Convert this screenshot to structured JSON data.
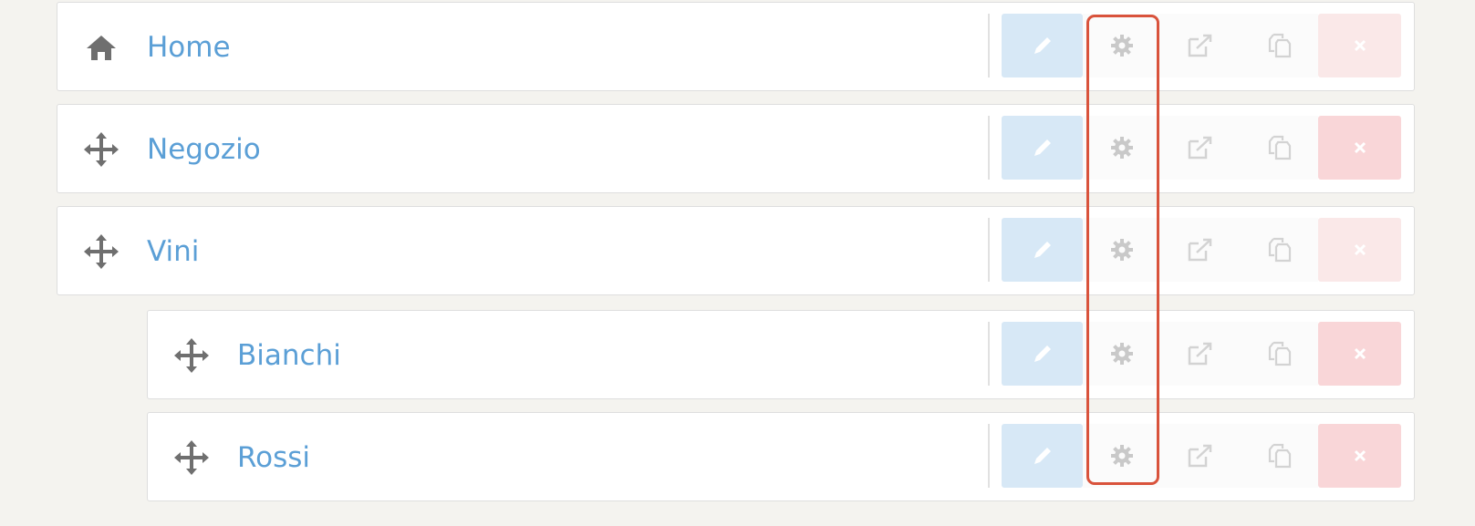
{
  "pages": [
    {
      "title": "Home",
      "lead_icon": "home-icon",
      "level": 0,
      "delete_faded": true
    },
    {
      "title": "Negozio",
      "lead_icon": "move-icon",
      "level": 0,
      "delete_faded": false
    },
    {
      "title": "Vini",
      "lead_icon": "move-icon",
      "level": 0,
      "delete_faded": true
    },
    {
      "title": "Bianchi",
      "lead_icon": "move-icon",
      "level": 1,
      "delete_faded": false
    },
    {
      "title": "Rossi",
      "lead_icon": "move-icon",
      "level": 1,
      "delete_faded": false
    }
  ],
  "actions": [
    "edit-icon",
    "gear-icon",
    "external-link-icon",
    "duplicate-icon",
    "close-icon"
  ],
  "colors": {
    "title_link": "#5b9fd6",
    "edit_bg": "#d7e8f6",
    "delete_bg": "#f9d6d8",
    "highlight": "#d9533c",
    "background": "#f4f3ef"
  }
}
